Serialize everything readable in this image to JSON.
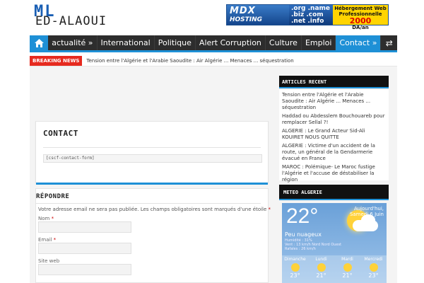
{
  "header": {
    "logo_ml": "ML",
    "logo_sub": "ED-ALAOUI"
  },
  "ad": {
    "brand": "MDX",
    "hosting": "HOSTING",
    "domains": ".org .name .biz .com .net .info .se",
    "right_title": "Hébergement Web Professionnelle",
    "price": "2000",
    "unit": "DA/an"
  },
  "nav": {
    "items": [
      {
        "label": "actualité »"
      },
      {
        "label": "International"
      },
      {
        "label": "Politique"
      },
      {
        "label": "Alert Corruption"
      },
      {
        "label": "Culture"
      },
      {
        "label": "Emploi"
      },
      {
        "label": "Contact »"
      }
    ]
  },
  "breaking": {
    "tag": "BREAKING NEWS",
    "text": "Tension entre l'Algérie et l'Arabie Saoudite : Air Algérie ... Menaces ... séquestration"
  },
  "contact": {
    "title": "CONTACT",
    "shortcode": "[cscf-contact-form]"
  },
  "reply": {
    "title": "RÉPONDRE",
    "note": "Votre adresse email ne sera pas publiée. Les champs obligatoires sont marqués d'une étoile",
    "required_mark": "*",
    "name_label": "Nom",
    "email_label": "Email",
    "site_label": "Site web"
  },
  "sidebar": {
    "articles_title": "ARTICLES RECENT",
    "articles": [
      "Tension entre l'Algérie et l'Arabie Saoudite : Air Algérie ... Menaces ... séquestration",
      "Haddad ou Abdesslem Bouchouareb pour remplacer Sellal ?!",
      "ALGERIE : Le Grand Acteur Sid-Ali KOUIRET NOUS QUITTE",
      "ALGERIE : Victime d'un accident de la route, un général de la Gendarmerie évacué en France",
      "MAROC : Polémique- Le Maroc fustige l'Algérie et l'accuse de déstabiliser la région"
    ],
    "meteo_title": "METEO ALGERIE"
  },
  "weather": {
    "temp": "22°",
    "today_label": "Aujourd'hui,",
    "today_date": "Samedi 6 Juin",
    "condition": "Peu nuageux",
    "humidity": "Humidité : 31%",
    "wind": "Vent : 13 km/h Nord Nord Ouest",
    "gusts": "Rafales : 26 km/h",
    "forecast": [
      {
        "day": "Dimanche",
        "temp": "23°"
      },
      {
        "day": "Lundi",
        "temp": "21°"
      },
      {
        "day": "Mardi",
        "temp": "21°"
      },
      {
        "day": "Mercredi",
        "temp": "23°"
      }
    ]
  },
  "colors": {
    "accent": "#1e90d6",
    "nav_bg": "#2d2d2d",
    "breaking": "#e62a1f"
  }
}
